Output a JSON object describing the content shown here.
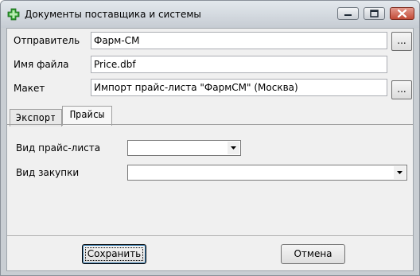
{
  "window": {
    "title": "Документы поставщика и системы",
    "title_icon": "green-cross-icon"
  },
  "form": {
    "sender_label": "Отправитель",
    "sender_value": "Фарм-СМ",
    "filename_label": "Имя файла",
    "filename_value": "Price.dbf",
    "template_label": "Макет",
    "template_value": "Импорт прайс-листа \"ФармСМ\" (Москва)",
    "browse_label": "..."
  },
  "tabs": [
    {
      "label": "Экспорт",
      "active": false
    },
    {
      "label": "Прайсы",
      "active": true
    }
  ],
  "prices_tab": {
    "price_type_label": "Вид прайс-листа",
    "price_type_value": "",
    "purchase_type_label": "Вид закупки",
    "purchase_type_value": ""
  },
  "buttons": {
    "save": "Сохранить",
    "cancel": "Отмена"
  }
}
